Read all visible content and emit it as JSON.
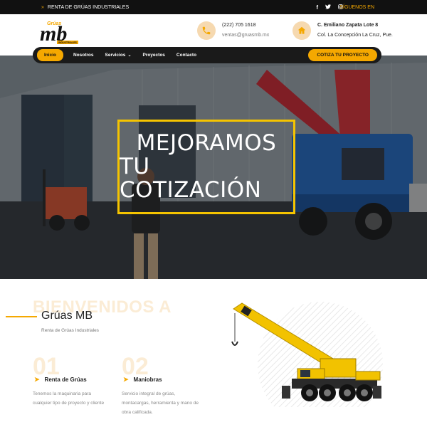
{
  "topbar": {
    "tagline": "RENTA DE GRÚAS INDUSTRIALES",
    "follow": "SÍGUENOS EN",
    "social": [
      "facebook-icon",
      "twitter-icon",
      "instagram-icon"
    ]
  },
  "logo": {
    "top": "Grúas",
    "main": "mb",
    "bottom": "INDUSTRIALES"
  },
  "contact": {
    "phone": "(222) 705 1618",
    "email": "ventas@gruasmb.mx",
    "address1": "C. Emiliano Zapata Lote 8",
    "address2": "Col. La Concepción La Cruz, Pue."
  },
  "nav": {
    "items": [
      "Inicio",
      "Nosotros",
      "Servicios",
      "Proyectos",
      "Contacto"
    ],
    "cta": "COTIZA TU PROYECTO"
  },
  "hero": {
    "line1": "MEJORAMOS",
    "line2": "TU COTIZACIÓN"
  },
  "welcome": {
    "ghost": "BIENVENIDOS A",
    "title": "Grúas MB",
    "subtitle": "Renta de Grúas Industriales"
  },
  "services": [
    {
      "num": "01",
      "title": "Renta de Grúas",
      "desc1": "Tenemos la maquinaria para",
      "desc2": "cualquier tipo de proyecto y cliente",
      "desc3": ""
    },
    {
      "num": "02",
      "title": "Maniobras",
      "desc1": "Servicio integral de grúas,",
      "desc2": "montacargas, herramienta y mano de",
      "desc3": "obra calificada."
    }
  ],
  "colors": {
    "accent": "#f5a800",
    "dark": "#1a1a1a",
    "hero_frame": "#f5c400"
  }
}
